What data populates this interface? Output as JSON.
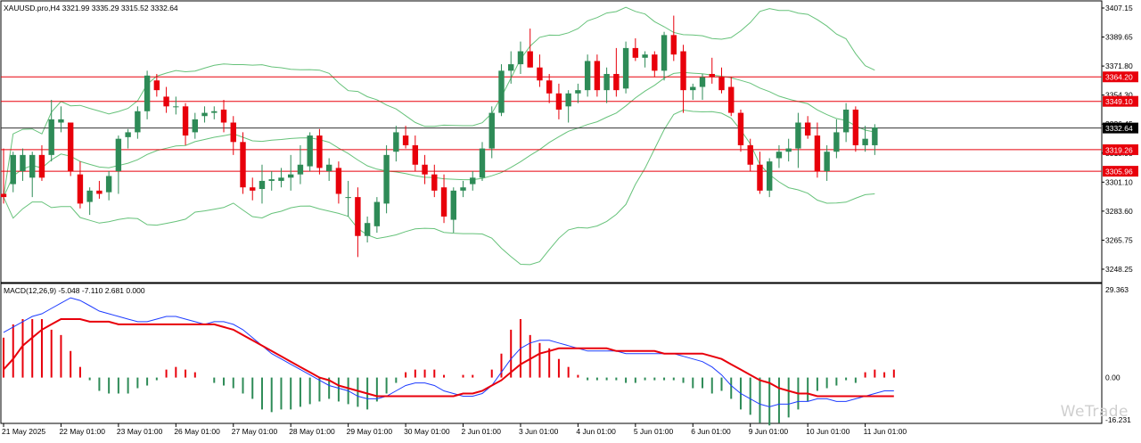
{
  "chart_data": {
    "type": "candlestick",
    "symbol_header": "XAUUSD.pro,H4  3321.99 3335.29 3315.52 3332.64",
    "main_panel": {
      "price_range": [
        3240,
        3410
      ],
      "price_ticks": [
        "3407.15",
        "3389.65",
        "3371.80",
        "3354.30",
        "3336.45",
        "3318.95",
        "3301.10",
        "3283.60",
        "3265.75",
        "3248.25"
      ],
      "current_price": 3332.64,
      "current_price_label": "3332.64",
      "horizontal_levels": [
        {
          "value": 3364.2,
          "label": "3364.20"
        },
        {
          "value": 3349.1,
          "label": "3349.10"
        },
        {
          "value": 3319.26,
          "label": "3319.26"
        },
        {
          "value": 3305.96,
          "label": "3305.96"
        }
      ],
      "candles": [
        {
          "o": 3292,
          "h": 3320,
          "l": 3286,
          "c": 3290
        },
        {
          "o": 3298,
          "h": 3318,
          "l": 3293,
          "c": 3316
        },
        {
          "o": 3306,
          "h": 3320,
          "l": 3300,
          "c": 3316
        },
        {
          "o": 3302,
          "h": 3318,
          "l": 3290,
          "c": 3316
        },
        {
          "o": 3316,
          "h": 3322,
          "l": 3300,
          "c": 3302
        },
        {
          "o": 3316,
          "h": 3350,
          "l": 3312,
          "c": 3338
        },
        {
          "o": 3336,
          "h": 3346,
          "l": 3330,
          "c": 3338
        },
        {
          "o": 3336,
          "h": 3336,
          "l": 3303,
          "c": 3306
        },
        {
          "o": 3304,
          "h": 3312,
          "l": 3283,
          "c": 3286
        },
        {
          "o": 3287,
          "h": 3296,
          "l": 3279,
          "c": 3294
        },
        {
          "o": 3294,
          "h": 3300,
          "l": 3289,
          "c": 3292
        },
        {
          "o": 3293,
          "h": 3306,
          "l": 3288,
          "c": 3303
        },
        {
          "o": 3306,
          "h": 3328,
          "l": 3292,
          "c": 3326
        },
        {
          "o": 3327,
          "h": 3332,
          "l": 3320,
          "c": 3330
        },
        {
          "o": 3330,
          "h": 3346,
          "l": 3326,
          "c": 3343
        },
        {
          "o": 3343,
          "h": 3368,
          "l": 3338,
          "c": 3365
        },
        {
          "o": 3362,
          "h": 3366,
          "l": 3352,
          "c": 3356
        },
        {
          "o": 3352,
          "h": 3358,
          "l": 3342,
          "c": 3346
        },
        {
          "o": 3346,
          "h": 3352,
          "l": 3341,
          "c": 3346
        },
        {
          "o": 3346,
          "h": 3348,
          "l": 3322,
          "c": 3328
        },
        {
          "o": 3330,
          "h": 3342,
          "l": 3326,
          "c": 3338
        },
        {
          "o": 3340,
          "h": 3346,
          "l": 3336,
          "c": 3342
        },
        {
          "o": 3342,
          "h": 3346,
          "l": 3338,
          "c": 3343
        },
        {
          "o": 3344,
          "h": 3350,
          "l": 3330,
          "c": 3336
        },
        {
          "o": 3336,
          "h": 3340,
          "l": 3316,
          "c": 3324
        },
        {
          "o": 3324,
          "h": 3330,
          "l": 3292,
          "c": 3296
        },
        {
          "o": 3296,
          "h": 3302,
          "l": 3288,
          "c": 3294
        },
        {
          "o": 3295,
          "h": 3310,
          "l": 3286,
          "c": 3300
        },
        {
          "o": 3300,
          "h": 3306,
          "l": 3294,
          "c": 3301
        },
        {
          "o": 3300,
          "h": 3308,
          "l": 3296,
          "c": 3302
        },
        {
          "o": 3302,
          "h": 3316,
          "l": 3294,
          "c": 3304
        },
        {
          "o": 3304,
          "h": 3322,
          "l": 3298,
          "c": 3310
        },
        {
          "o": 3309,
          "h": 3330,
          "l": 3306,
          "c": 3328
        },
        {
          "o": 3328,
          "h": 3332,
          "l": 3304,
          "c": 3308
        },
        {
          "o": 3306,
          "h": 3314,
          "l": 3300,
          "c": 3310
        },
        {
          "o": 3308,
          "h": 3312,
          "l": 3286,
          "c": 3292
        },
        {
          "o": 3290,
          "h": 3300,
          "l": 3278,
          "c": 3290
        },
        {
          "o": 3290,
          "h": 3296,
          "l": 3253,
          "c": 3266
        },
        {
          "o": 3266,
          "h": 3278,
          "l": 3262,
          "c": 3274
        },
        {
          "o": 3272,
          "h": 3290,
          "l": 3268,
          "c": 3287
        },
        {
          "o": 3286,
          "h": 3322,
          "l": 3280,
          "c": 3316
        },
        {
          "o": 3318,
          "h": 3334,
          "l": 3312,
          "c": 3330
        },
        {
          "o": 3328,
          "h": 3334,
          "l": 3320,
          "c": 3322
        },
        {
          "o": 3322,
          "h": 3328,
          "l": 3306,
          "c": 3310
        },
        {
          "o": 3310,
          "h": 3316,
          "l": 3298,
          "c": 3304
        },
        {
          "o": 3304,
          "h": 3310,
          "l": 3290,
          "c": 3294
        },
        {
          "o": 3296,
          "h": 3304,
          "l": 3274,
          "c": 3278
        },
        {
          "o": 3276,
          "h": 3296,
          "l": 3268,
          "c": 3294
        },
        {
          "o": 3294,
          "h": 3300,
          "l": 3290,
          "c": 3296
        },
        {
          "o": 3298,
          "h": 3306,
          "l": 3294,
          "c": 3302
        },
        {
          "o": 3302,
          "h": 3324,
          "l": 3300,
          "c": 3320
        },
        {
          "o": 3320,
          "h": 3346,
          "l": 3314,
          "c": 3342
        },
        {
          "o": 3342,
          "h": 3372,
          "l": 3340,
          "c": 3368
        },
        {
          "o": 3368,
          "h": 3380,
          "l": 3360,
          "c": 3372
        },
        {
          "o": 3372,
          "h": 3386,
          "l": 3366,
          "c": 3380
        },
        {
          "o": 3380,
          "h": 3394,
          "l": 3370,
          "c": 3370
        },
        {
          "o": 3370,
          "h": 3378,
          "l": 3358,
          "c": 3362
        },
        {
          "o": 3362,
          "h": 3366,
          "l": 3348,
          "c": 3354
        },
        {
          "o": 3354,
          "h": 3360,
          "l": 3338,
          "c": 3344
        },
        {
          "o": 3346,
          "h": 3356,
          "l": 3336,
          "c": 3354
        },
        {
          "o": 3354,
          "h": 3360,
          "l": 3348,
          "c": 3356
        },
        {
          "o": 3356,
          "h": 3378,
          "l": 3352,
          "c": 3374
        },
        {
          "o": 3374,
          "h": 3378,
          "l": 3352,
          "c": 3356
        },
        {
          "o": 3356,
          "h": 3370,
          "l": 3348,
          "c": 3366
        },
        {
          "o": 3366,
          "h": 3382,
          "l": 3352,
          "c": 3356
        },
        {
          "o": 3357,
          "h": 3386,
          "l": 3354,
          "c": 3382
        },
        {
          "o": 3382,
          "h": 3388,
          "l": 3374,
          "c": 3376
        },
        {
          "o": 3376,
          "h": 3380,
          "l": 3370,
          "c": 3378
        },
        {
          "o": 3378,
          "h": 3380,
          "l": 3364,
          "c": 3368
        },
        {
          "o": 3368,
          "h": 3392,
          "l": 3362,
          "c": 3390
        },
        {
          "o": 3390,
          "h": 3402,
          "l": 3374,
          "c": 3378
        },
        {
          "o": 3380,
          "h": 3384,
          "l": 3342,
          "c": 3356
        },
        {
          "o": 3356,
          "h": 3360,
          "l": 3350,
          "c": 3358
        },
        {
          "o": 3358,
          "h": 3366,
          "l": 3350,
          "c": 3364
        },
        {
          "o": 3366,
          "h": 3376,
          "l": 3360,
          "c": 3364
        },
        {
          "o": 3364,
          "h": 3370,
          "l": 3354,
          "c": 3356
        },
        {
          "o": 3358,
          "h": 3364,
          "l": 3340,
          "c": 3342
        },
        {
          "o": 3342,
          "h": 3344,
          "l": 3318,
          "c": 3322
        },
        {
          "o": 3322,
          "h": 3326,
          "l": 3306,
          "c": 3310
        },
        {
          "o": 3310,
          "h": 3318,
          "l": 3292,
          "c": 3294
        },
        {
          "o": 3294,
          "h": 3314,
          "l": 3290,
          "c": 3312
        },
        {
          "o": 3314,
          "h": 3322,
          "l": 3308,
          "c": 3318
        },
        {
          "o": 3318,
          "h": 3326,
          "l": 3312,
          "c": 3320
        },
        {
          "o": 3320,
          "h": 3342,
          "l": 3308,
          "c": 3336
        },
        {
          "o": 3336,
          "h": 3340,
          "l": 3326,
          "c": 3328
        },
        {
          "o": 3328,
          "h": 3336,
          "l": 3302,
          "c": 3306
        },
        {
          "o": 3306,
          "h": 3322,
          "l": 3300,
          "c": 3318
        },
        {
          "o": 3318,
          "h": 3338,
          "l": 3314,
          "c": 3330
        },
        {
          "o": 3330,
          "h": 3348,
          "l": 3324,
          "c": 3344
        },
        {
          "o": 3344,
          "h": 3346,
          "l": 3318,
          "c": 3322
        },
        {
          "o": 3322,
          "h": 3334,
          "l": 3318,
          "c": 3326
        },
        {
          "o": 3322,
          "h": 3335,
          "l": 3316,
          "c": 3333
        }
      ]
    },
    "macd_panel": {
      "label": "MACD(12,26,9) -5.048 -7.110 2.681 0.000",
      "value_ticks": [
        "29.363",
        "0.00",
        "-16.231"
      ],
      "range": [
        -16.231,
        29.363
      ],
      "histogram": [
        15,
        20,
        22,
        22,
        22,
        18,
        16,
        10,
        4,
        -1,
        -5,
        -6,
        -6,
        -6,
        -4,
        -3,
        -1,
        3,
        4,
        3,
        2,
        0,
        -2,
        -3,
        -4,
        -6,
        -8,
        -12,
        -13,
        -12,
        -12,
        -11,
        -10,
        -9,
        -8,
        -9,
        -10,
        -11,
        -12,
        -9,
        -6,
        -2,
        2,
        3,
        3,
        3,
        1,
        0,
        1,
        1,
        0,
        3,
        9,
        18,
        22,
        16,
        13,
        11,
        7,
        4,
        1,
        -1,
        -1,
        -1,
        -1,
        -2,
        -2,
        -1,
        -1,
        -1,
        -1,
        -2,
        -4,
        -4,
        -6,
        -5,
        -8,
        -12,
        -14,
        -17,
        -18,
        -17,
        -15,
        -12,
        -9,
        -5,
        -4,
        -3,
        -1,
        -2,
        2,
        3,
        2,
        3
      ],
      "macd_line": [
        17,
        19,
        21,
        23,
        24,
        26,
        28,
        30,
        29,
        27,
        25,
        24,
        23,
        22,
        21,
        21,
        22,
        23,
        23,
        22,
        21,
        20,
        21,
        21,
        20,
        18,
        15,
        12,
        9,
        7,
        5,
        3,
        1,
        -1,
        -3,
        -4,
        -5,
        -7,
        -8,
        -8,
        -7,
        -5,
        -3,
        -2,
        -2,
        -3,
        -5,
        -6,
        -7,
        -7,
        -6,
        -3,
        2,
        7,
        11,
        13,
        14,
        14,
        13,
        12,
        11,
        10,
        10,
        10,
        10,
        9,
        9,
        9,
        9,
        9,
        9,
        8,
        7,
        6,
        4,
        1,
        -3,
        -6,
        -8,
        -10,
        -11,
        -10,
        -10,
        -9,
        -9,
        -8,
        -8,
        -9,
        -9,
        -8,
        -7,
        -6,
        -5,
        -5
      ],
      "signal_line": [
        3,
        7,
        12,
        15,
        18,
        20,
        22,
        22,
        22,
        21,
        21,
        21,
        20,
        20,
        20,
        20,
        20,
        20,
        20,
        20,
        20,
        20,
        20,
        19,
        18,
        16,
        14,
        12,
        10,
        8,
        6,
        4,
        2,
        0,
        -1,
        -3,
        -4,
        -5,
        -6,
        -7,
        -7,
        -7,
        -7,
        -7,
        -7,
        -7,
        -7,
        -7,
        -6,
        -6,
        -5,
        -3,
        -1,
        2,
        5,
        7,
        9,
        10,
        11,
        11,
        11,
        11,
        11,
        11,
        10,
        10,
        10,
        10,
        10,
        9,
        9,
        9,
        9,
        9,
        8,
        7,
        5,
        3,
        1,
        -1,
        -2,
        -4,
        -5,
        -6,
        -6,
        -7,
        -7,
        -7,
        -7,
        -7,
        -7,
        -7,
        -7,
        -7
      ]
    },
    "time_axis": [
      {
        "index": 0,
        "label": "21 May 2025"
      },
      {
        "index": 6,
        "label": "22 May 01:00"
      },
      {
        "index": 12,
        "label": "23 May 01:00"
      },
      {
        "index": 18,
        "label": "26 May 01:00"
      },
      {
        "index": 24,
        "label": "27 May 01:00"
      },
      {
        "index": 30,
        "label": "28 May 01:00"
      },
      {
        "index": 36,
        "label": "29 May 01:00"
      },
      {
        "index": 42,
        "label": "30 May 01:00"
      },
      {
        "index": 48,
        "label": "2 Jun 01:00"
      },
      {
        "index": 54,
        "label": "3 Jun 01:00"
      },
      {
        "index": 60,
        "label": "4 Jun 01:00"
      },
      {
        "index": 66,
        "label": "5 Jun 01:00"
      },
      {
        "index": 72,
        "label": "6 Jun 01:00"
      },
      {
        "index": 78,
        "label": "9 Jun 01:00"
      },
      {
        "index": 84,
        "label": "10 Jun 01:00"
      },
      {
        "index": 90,
        "label": "11 Jun 01:00"
      }
    ],
    "colors": {
      "bull": "#2e8b57",
      "bear": "#e8000b",
      "bands": "#66c27a",
      "level": "#e8000b",
      "price_line": "#333333",
      "macd": "#1e3cff",
      "signal": "#e8000b",
      "hist_pos": "#e8000b",
      "hist_neg": "#2e8b57"
    }
  },
  "watermark": "WeTrade"
}
